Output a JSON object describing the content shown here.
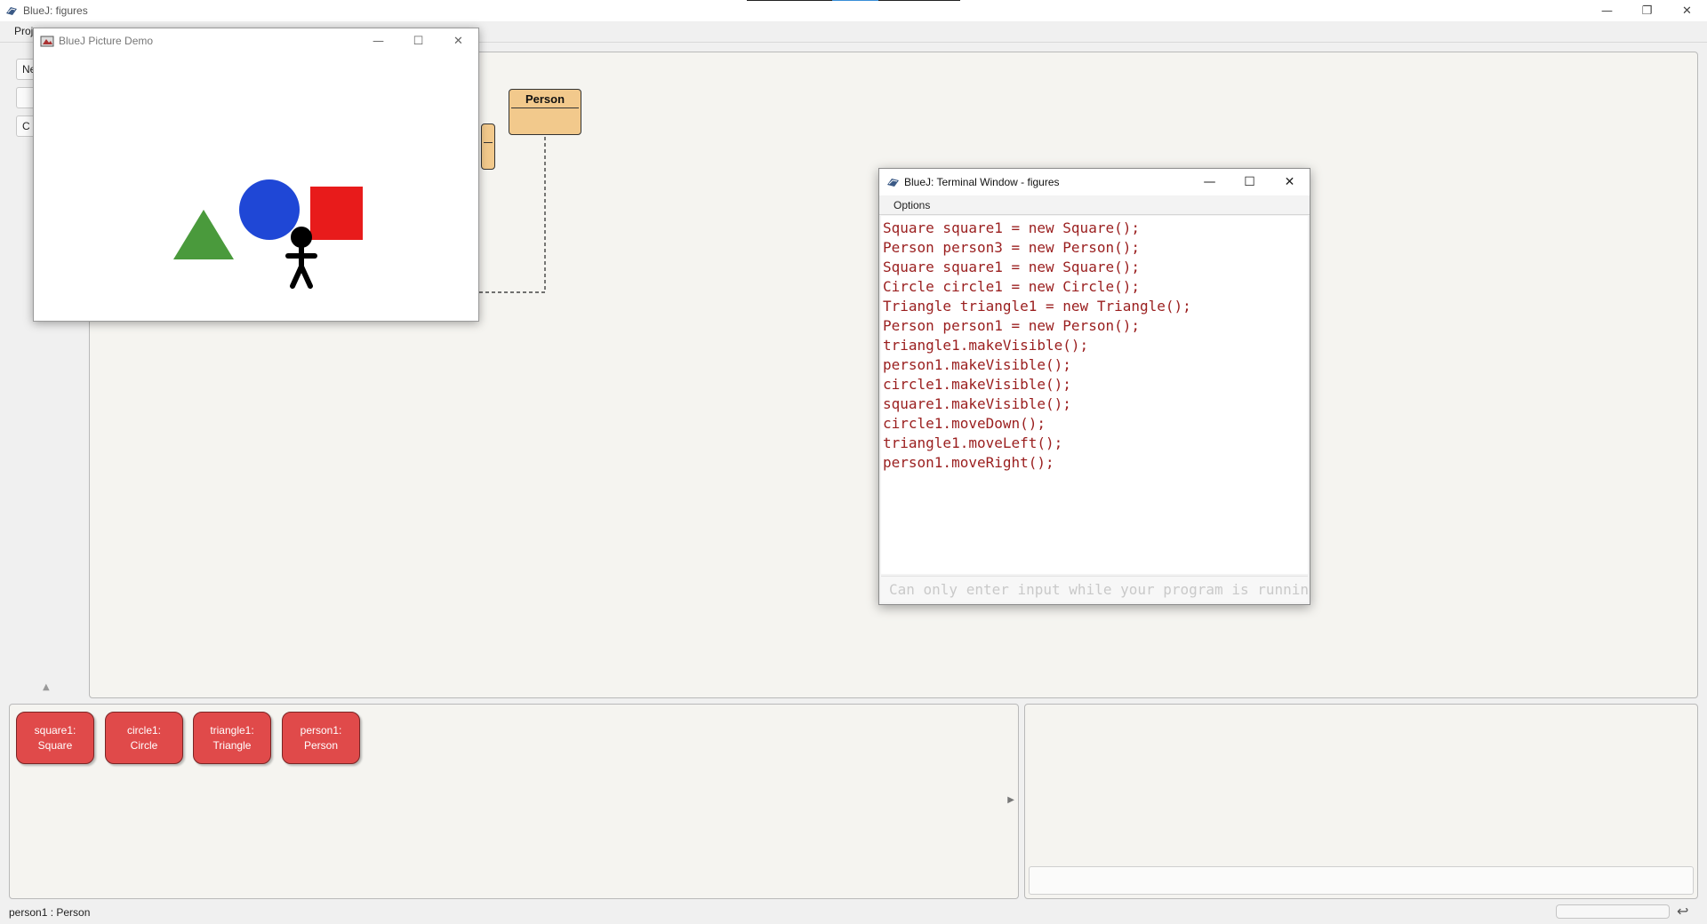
{
  "main_window": {
    "title": "BlueJ:  figures",
    "controls": {
      "minimize": "—",
      "restore": "❐",
      "close": "✕"
    }
  },
  "menubar": {
    "project": "Proj"
  },
  "toolbar": {
    "new_class": "Ne",
    "button2": "",
    "button3": "C"
  },
  "diagram": {
    "classes": [
      {
        "name": "Person"
      },
      {
        "name": ""
      }
    ]
  },
  "object_bench": {
    "objects": [
      {
        "name": "square1:",
        "type": "Square"
      },
      {
        "name": "circle1:",
        "type": "Circle"
      },
      {
        "name": "triangle1:",
        "type": "Triangle"
      },
      {
        "name": "person1:",
        "type": "Person"
      }
    ]
  },
  "statusbar": {
    "text": "person1 : Person"
  },
  "picture_window": {
    "title": "BlueJ Picture Demo",
    "shape_colors": {
      "triangle": "#4a9a3c",
      "circle": "#1f47d6",
      "square": "#e81b1b",
      "person": "#000000"
    }
  },
  "terminal_window": {
    "title": "BlueJ: Terminal Window - figures",
    "menu_options": "Options",
    "output_lines": [
      "Square square1 = new Square();",
      "Person person3 = new Person();",
      "Square square1 = new Square();",
      "Circle circle1 = new Circle();",
      "Triangle triangle1 = new Triangle();",
      "Person person1 = new Person();",
      "triangle1.makeVisible();",
      "person1.makeVisible();",
      "circle1.makeVisible();",
      "square1.makeVisible();",
      "circle1.moveDown();",
      "triangle1.moveLeft();",
      "person1.moveRight();"
    ],
    "input_placeholder": "Can only enter input while your program is running",
    "output_color": "#9a1e1e"
  }
}
